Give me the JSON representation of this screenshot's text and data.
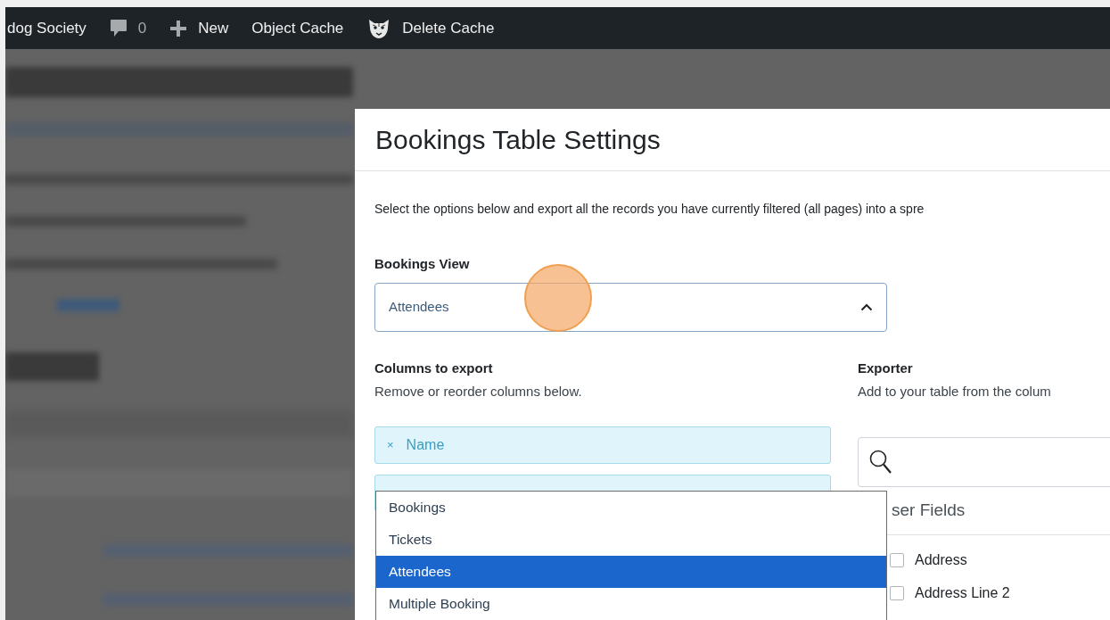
{
  "admin_bar": {
    "items": [
      {
        "kind": "text",
        "label": "dog Society"
      },
      {
        "kind": "comments",
        "label": "0"
      },
      {
        "kind": "new",
        "label": "New"
      },
      {
        "kind": "text",
        "label": "Object Cache"
      },
      {
        "kind": "cache",
        "label": "Delete Cache"
      }
    ]
  },
  "modal": {
    "title": "Bookings Table Settings",
    "intro": "Select the options below and export all the records you have currently filtered (all pages) into a spre",
    "view": {
      "label": "Bookings View",
      "value": "Attendees",
      "expanded": true,
      "options": [
        {
          "label": "Bookings",
          "selected": false
        },
        {
          "label": "Tickets",
          "selected": false
        },
        {
          "label": "Attendees",
          "selected": true
        },
        {
          "label": "Multiple Booking",
          "selected": false
        }
      ]
    },
    "columns": {
      "title": "Columns to export",
      "hint": "Remove or reorder columns below.",
      "items": [
        {
          "remove": "×",
          "label": "Name"
        }
      ]
    },
    "exporter": {
      "title": "Exporter",
      "hint": "Add to your table from the colum",
      "group": "ser Fields",
      "fields": [
        {
          "label": "Address",
          "checked": false
        },
        {
          "label": "Address Line 2",
          "checked": false
        }
      ]
    }
  }
}
